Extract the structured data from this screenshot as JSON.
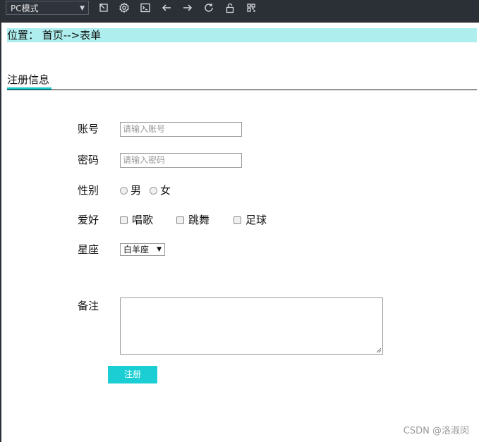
{
  "toolbar": {
    "mode_label": "PC模式",
    "icons": [
      "pop-out-icon",
      "gear-icon",
      "terminal-icon",
      "back-arrow-icon",
      "forward-arrow-icon",
      "refresh-icon",
      "unlock-icon",
      "qr-code-icon"
    ]
  },
  "breadcrumb": {
    "text": "位置： 首页-->表单"
  },
  "section": {
    "title": "注册信息"
  },
  "form": {
    "account_label": "账号",
    "account_placeholder": "请输入账号",
    "password_label": "密码",
    "password_placeholder": "请输入密码",
    "gender_label": "性别",
    "gender_options": [
      "男",
      "女"
    ],
    "hobby_label": "爱好",
    "hobby_options": [
      "唱歌",
      "跳舞",
      "足球"
    ],
    "zodiac_label": "星座",
    "zodiac_selected": "白羊座",
    "note_label": "备注",
    "submit_label": "注册"
  },
  "watermark": "CSDN @洛淑闵",
  "colors": {
    "accent": "#1bced4",
    "breadcrumb_bg": "#aeeeee",
    "toolbar_bg": "#2b2f36"
  }
}
